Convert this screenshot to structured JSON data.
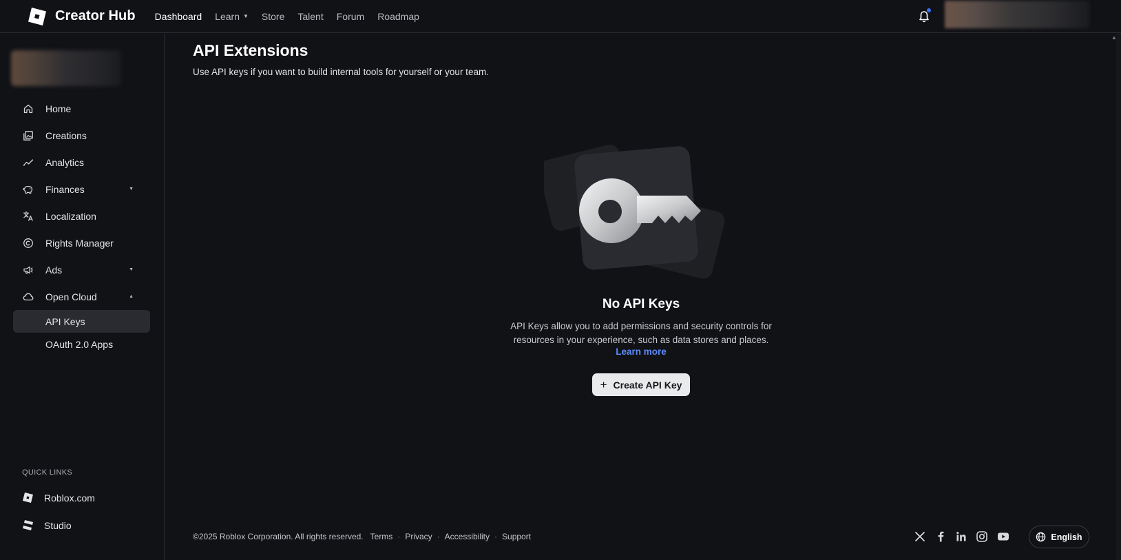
{
  "header": {
    "brand": "Creator Hub",
    "nav": [
      "Dashboard",
      "Learn",
      "Store",
      "Talent",
      "Forum",
      "Roadmap"
    ]
  },
  "sidebar": {
    "items": [
      {
        "label": "Home",
        "icon": "home-icon"
      },
      {
        "label": "Creations",
        "icon": "creations-icon"
      },
      {
        "label": "Analytics",
        "icon": "analytics-icon"
      },
      {
        "label": "Finances",
        "icon": "piggy-bank-icon"
      },
      {
        "label": "Localization",
        "icon": "translate-icon"
      },
      {
        "label": "Rights Manager",
        "icon": "copyright-icon"
      },
      {
        "label": "Ads",
        "icon": "megaphone-icon"
      },
      {
        "label": "Open Cloud",
        "icon": "cloud-icon"
      }
    ],
    "sub_items": [
      "API Keys",
      "OAuth 2.0 Apps"
    ],
    "quick_links_title": "QUICK LINKS",
    "quick_links": [
      "Roblox.com",
      "Studio"
    ]
  },
  "main": {
    "title": "API Extensions",
    "subtitle": "Use API keys if you want to build internal tools for yourself or your team.",
    "empty_title": "No API Keys",
    "empty_desc_line1": "API Keys allow you to add permissions and security controls for",
    "empty_desc_line2": "resources in your experience, such as data stores and places.",
    "learn_more": "Learn more",
    "create_button": "Create API Key"
  },
  "footer": {
    "copyright": "©2025 Roblox Corporation. All rights reserved.",
    "links": [
      "Terms",
      "Privacy",
      "Accessibility",
      "Support"
    ],
    "separator": "·",
    "language": "English"
  },
  "colors": {
    "background": "#111216",
    "link_blue": "#5b8af7",
    "notification_dot": "#3b6ff5"
  }
}
